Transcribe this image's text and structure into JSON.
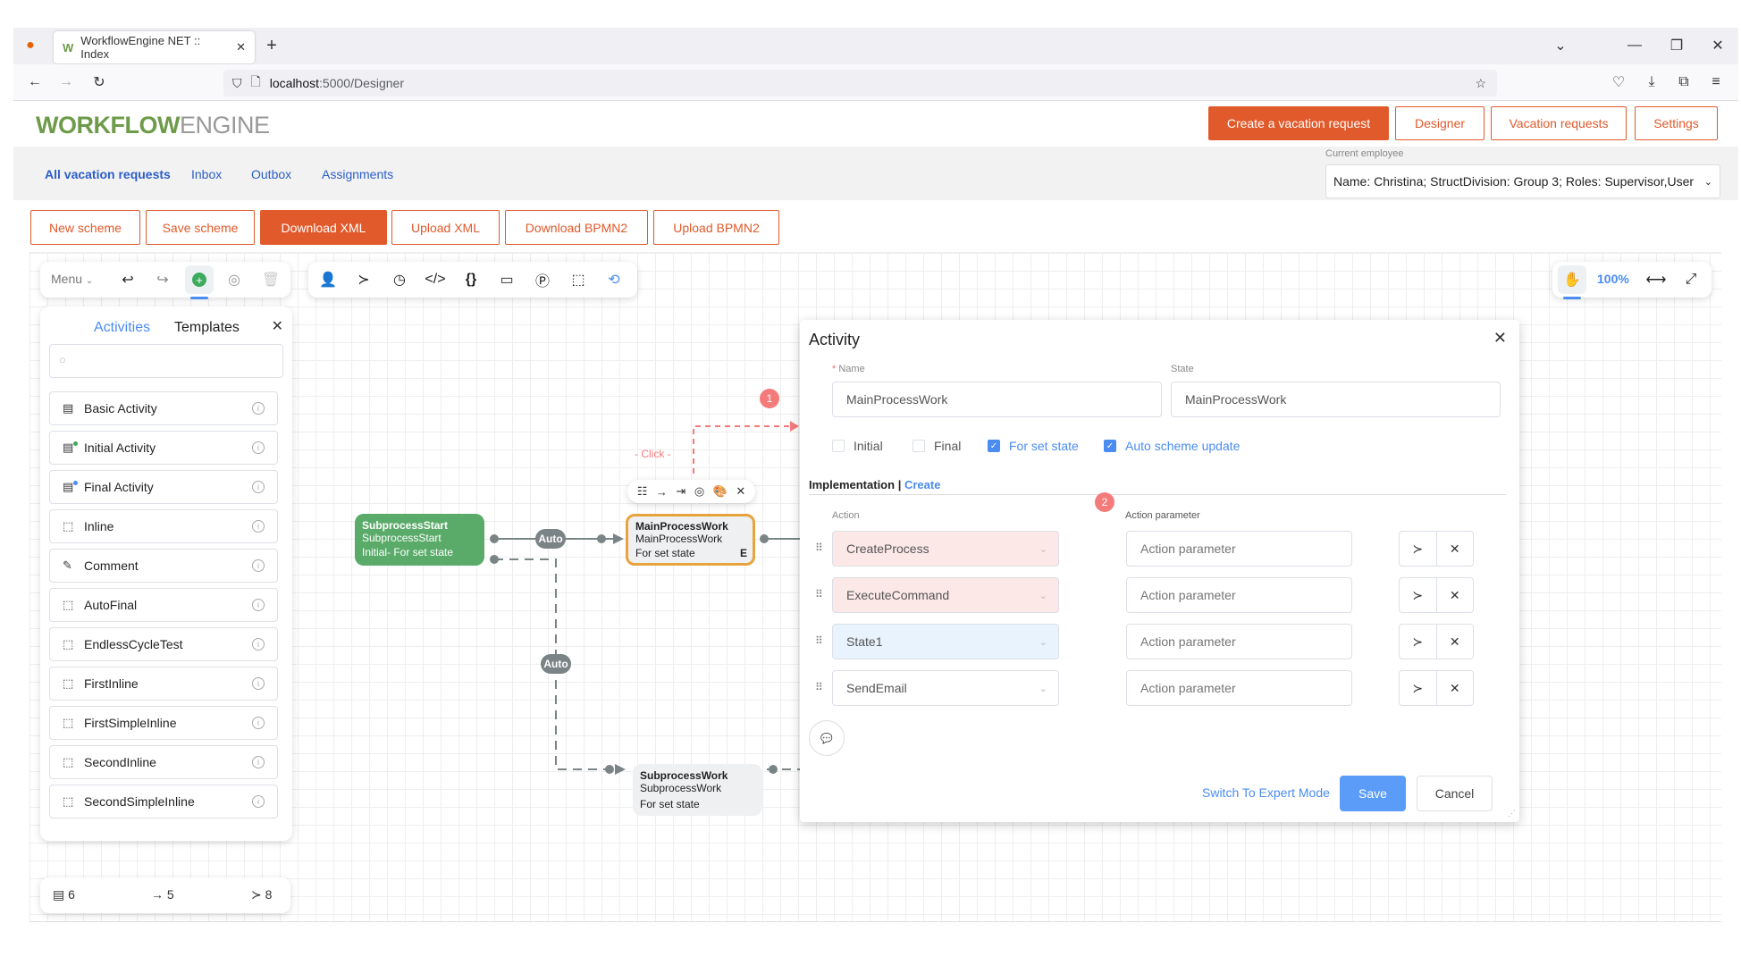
{
  "browser": {
    "tab_title": "WorkflowEngine NET :: Index",
    "url_host": "localhost",
    "url_path": ":5000/Designer"
  },
  "header": {
    "logo_bold": "WORKFLOW",
    "logo_light": "ENGINE",
    "buttons": [
      "Create a vacation request",
      "Designer",
      "Vacation requests",
      "Settings"
    ]
  },
  "nav": {
    "links": [
      "All vacation requests",
      "Inbox",
      "Outbox",
      "Assignments"
    ],
    "employee_label": "Current employee",
    "employee_value": "Name: Christina; StructDivision: Group 3; Roles: Supervisor,User"
  },
  "scheme_buttons": [
    "New scheme",
    "Save scheme",
    "Download XML",
    "Upload XML",
    "Download BPMN2",
    "Upload BPMN2"
  ],
  "toolbar": {
    "menu_label": "Menu",
    "zoom_level": "100%"
  },
  "activities_panel": {
    "tabs": [
      "Activities",
      "Templates"
    ],
    "search_placeholder": "",
    "items": [
      "Basic Activity",
      "Initial Activity",
      "Final Activity",
      "Inline",
      "Comment",
      "AutoFinal",
      "EndlessCycleTest",
      "FirstInline",
      "FirstSimpleInline",
      "SecondInline",
      "SecondSimpleInline"
    ]
  },
  "stats": {
    "activities": "6",
    "transitions": "5",
    "commands": "8"
  },
  "diagram": {
    "nodes": [
      {
        "title": "SubprocessStart",
        "subtitle": "SubprocessStart",
        "desc": "Initial- For set state"
      },
      {
        "title": "MainProcessWork",
        "subtitle": "MainProcessWork",
        "desc": "For set state",
        "flag": "E"
      },
      {
        "title": "SubprocessWork",
        "subtitle": "SubprocessWork",
        "desc": "For set state"
      }
    ],
    "transition_labels": [
      "Auto",
      "Auto"
    ],
    "click_hint": "Click",
    "badge1": "1",
    "badge2": "2"
  },
  "dialog": {
    "title": "Activity",
    "name_label": "Name",
    "name_value": "MainProcessWork",
    "state_label": "State",
    "state_value": "MainProcessWork",
    "checkboxes": [
      {
        "label": "Initial",
        "checked": false
      },
      {
        "label": "Final",
        "checked": false
      },
      {
        "label": "For set state",
        "checked": true
      },
      {
        "label": "Auto scheme update",
        "checked": true
      }
    ],
    "implementation_label": "Implementation",
    "create_link": "Create",
    "action_header": "Action",
    "param_header": "Action parameter",
    "actions": [
      {
        "action": "CreateProcess",
        "param_placeholder": "Action parameter"
      },
      {
        "action": "ExecuteCommand",
        "param_placeholder": "Action parameter"
      },
      {
        "action": "State1",
        "param_placeholder": "Action parameter"
      },
      {
        "action": "SendEmail",
        "param_placeholder": "Action parameter"
      }
    ],
    "expert_mode_link": "Switch To Expert Mode",
    "save_label": "Save",
    "cancel_label": "Cancel"
  }
}
